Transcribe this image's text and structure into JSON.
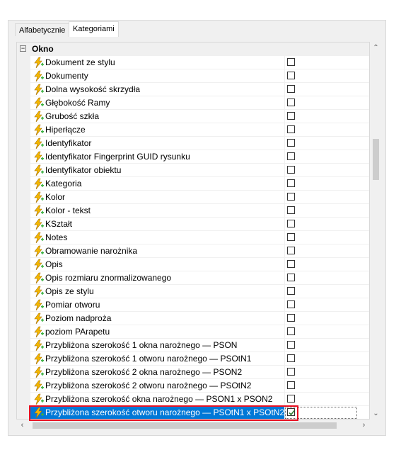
{
  "tabs": [
    {
      "label": "Alfabetycznie",
      "active": false
    },
    {
      "label": "Kategoriami",
      "active": true
    }
  ],
  "category": {
    "label": "Okno",
    "expander": "⊟"
  },
  "properties": [
    {
      "label": "Dokument ze stylu",
      "checked": false
    },
    {
      "label": "Dokumenty",
      "checked": false
    },
    {
      "label": "Dolna wysokość skrzydła",
      "checked": false
    },
    {
      "label": "Głębokość Ramy",
      "checked": false
    },
    {
      "label": "Grubość szkła",
      "checked": false
    },
    {
      "label": "Hiperłącze",
      "checked": false
    },
    {
      "label": "Identyfikator",
      "checked": false
    },
    {
      "label": "Identyfikator Fingerprint GUID rysunku",
      "checked": false
    },
    {
      "label": "Identyfikator obiektu",
      "checked": false
    },
    {
      "label": "Kategoria",
      "checked": false
    },
    {
      "label": "Kolor",
      "checked": false
    },
    {
      "label": "Kolor - tekst",
      "checked": false
    },
    {
      "label": "KSztałt",
      "checked": false
    },
    {
      "label": "Notes",
      "checked": false
    },
    {
      "label": "Obramowanie narożnika",
      "checked": false
    },
    {
      "label": "Opis",
      "checked": false
    },
    {
      "label": "Opis rozmiaru znormalizowanego",
      "checked": false
    },
    {
      "label": "Opis ze stylu",
      "checked": false
    },
    {
      "label": "Pomiar otworu",
      "checked": false
    },
    {
      "label": "Poziom nadproża",
      "checked": false
    },
    {
      "label": "poziom PArapetu",
      "checked": false
    },
    {
      "label": "Przybliżona szerokość 1 okna narożnego — PSON",
      "checked": false
    },
    {
      "label": "Przybliżona szerokość 1 otworu narożnego — PSOtN1",
      "checked": false
    },
    {
      "label": "Przybliżona szerokość 2 okna narożnego — PSON2",
      "checked": false
    },
    {
      "label": "Przybliżona szerokość 2 otworu narożnego — PSOtN2",
      "checked": false
    },
    {
      "label": "Przybliżona szerokość okna narożnego — PSON1 x PSON2",
      "checked": false
    },
    {
      "label": "Przybliżona szerokość otworu narożnego — PSOtN1 x PSOtN2",
      "checked": true,
      "selected": true
    }
  ],
  "icons": {
    "property": "lightning-icon",
    "check": "checkmark-icon"
  },
  "colors": {
    "selection": "#0078d7",
    "highlight_outline": "#e81123",
    "check": "#2e7d32",
    "icon_yellow": "#f5b800",
    "icon_green": "#3cb043"
  }
}
